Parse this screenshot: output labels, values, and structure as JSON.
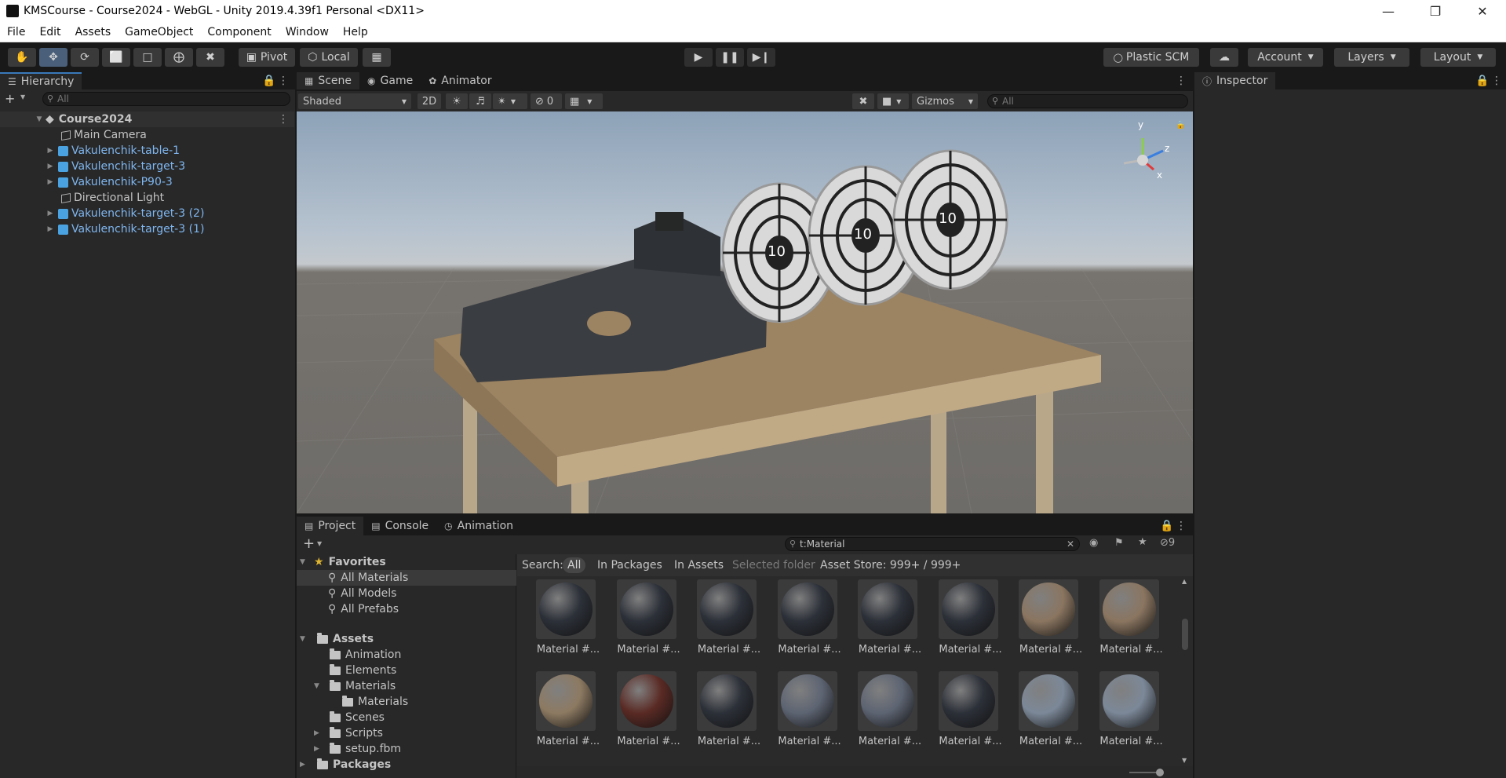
{
  "window": {
    "title": "KMSCourse - Course2024 - WebGL - Unity 2019.4.39f1 Personal <DX11>"
  },
  "menu": [
    "File",
    "Edit",
    "Assets",
    "GameObject",
    "Component",
    "Window",
    "Help"
  ],
  "toolbar": {
    "pivot": "Pivot",
    "local": "Local",
    "plastic": "Plastic SCM",
    "account": "Account",
    "layers": "Layers",
    "layout": "Layout"
  },
  "hierarchy": {
    "tab": "Hierarchy",
    "search_placeholder": "All",
    "scene": "Course2024",
    "items": [
      {
        "label": "Main Camera",
        "prefab": false,
        "expandable": false
      },
      {
        "label": "Vakulenchik-table-1",
        "prefab": true,
        "expandable": true
      },
      {
        "label": "Vakulenchik-target-3",
        "prefab": true,
        "expandable": true
      },
      {
        "label": "Vakulenchik-P90-3",
        "prefab": true,
        "expandable": true
      },
      {
        "label": "Directional Light",
        "prefab": false,
        "expandable": false
      },
      {
        "label": "Vakulenchik-target-3 (2)",
        "prefab": true,
        "expandable": true
      },
      {
        "label": "Vakulenchik-target-3 (1)",
        "prefab": true,
        "expandable": true
      }
    ]
  },
  "scene_tabs": {
    "scene": "Scene",
    "game": "Game",
    "animator": "Animator"
  },
  "scene_toolbar": {
    "shading": "Shaded",
    "mode2d": "2D",
    "hidden_count": "0",
    "gizmos": "Gizmos",
    "search_placeholder": "All"
  },
  "scene_view": {
    "target_score": "10",
    "gizmo_axes": {
      "y": "y",
      "z": "z",
      "x": "x"
    }
  },
  "inspector": {
    "tab": "Inspector"
  },
  "project": {
    "tabs": {
      "project": "Project",
      "console": "Console",
      "animation": "Animation"
    },
    "search_value": "t:Material",
    "hidden_count": "9",
    "search_bar": {
      "label": "Search:",
      "all": "All",
      "in_packages": "In Packages",
      "in_assets": "In Assets",
      "selected_folder": "Selected folder",
      "asset_store": "Asset Store: 999+ / 999+"
    },
    "favorites": {
      "label": "Favorites",
      "items": [
        "All Materials",
        "All Models",
        "All Prefabs"
      ]
    },
    "assets": {
      "label": "Assets",
      "folders": [
        "Animation",
        "Elements",
        "Materials",
        "Materials",
        "Scenes",
        "Scripts",
        "setup.fbm"
      ]
    },
    "packages": "Packages",
    "materials": [
      {
        "label": "Material #...",
        "color": "#2c3038"
      },
      {
        "label": "Material #...",
        "color": "#2c3038"
      },
      {
        "label": "Material #...",
        "color": "#2c3038"
      },
      {
        "label": "Material #...",
        "color": "#2c3038"
      },
      {
        "label": "Material #...",
        "color": "#2c3038"
      },
      {
        "label": "Material #...",
        "color": "#2c3038"
      },
      {
        "label": "Material #...",
        "color": "#8a7560"
      },
      {
        "label": "Material #...",
        "color": "#8a7560"
      },
      {
        "label": "Material #...",
        "color": "#8d7a62"
      },
      {
        "label": "Material #...",
        "color": "#5a2a24"
      },
      {
        "label": "Material #...",
        "color": "#2c3038"
      },
      {
        "label": "Material #...",
        "color": "#5d6472"
      },
      {
        "label": "Material #...",
        "color": "#5d6472"
      },
      {
        "label": "Material #...",
        "color": "#2c3038"
      },
      {
        "label": "Material #...",
        "color": "#7c8898"
      },
      {
        "label": "Material #...",
        "color": "#7c8898"
      }
    ]
  }
}
